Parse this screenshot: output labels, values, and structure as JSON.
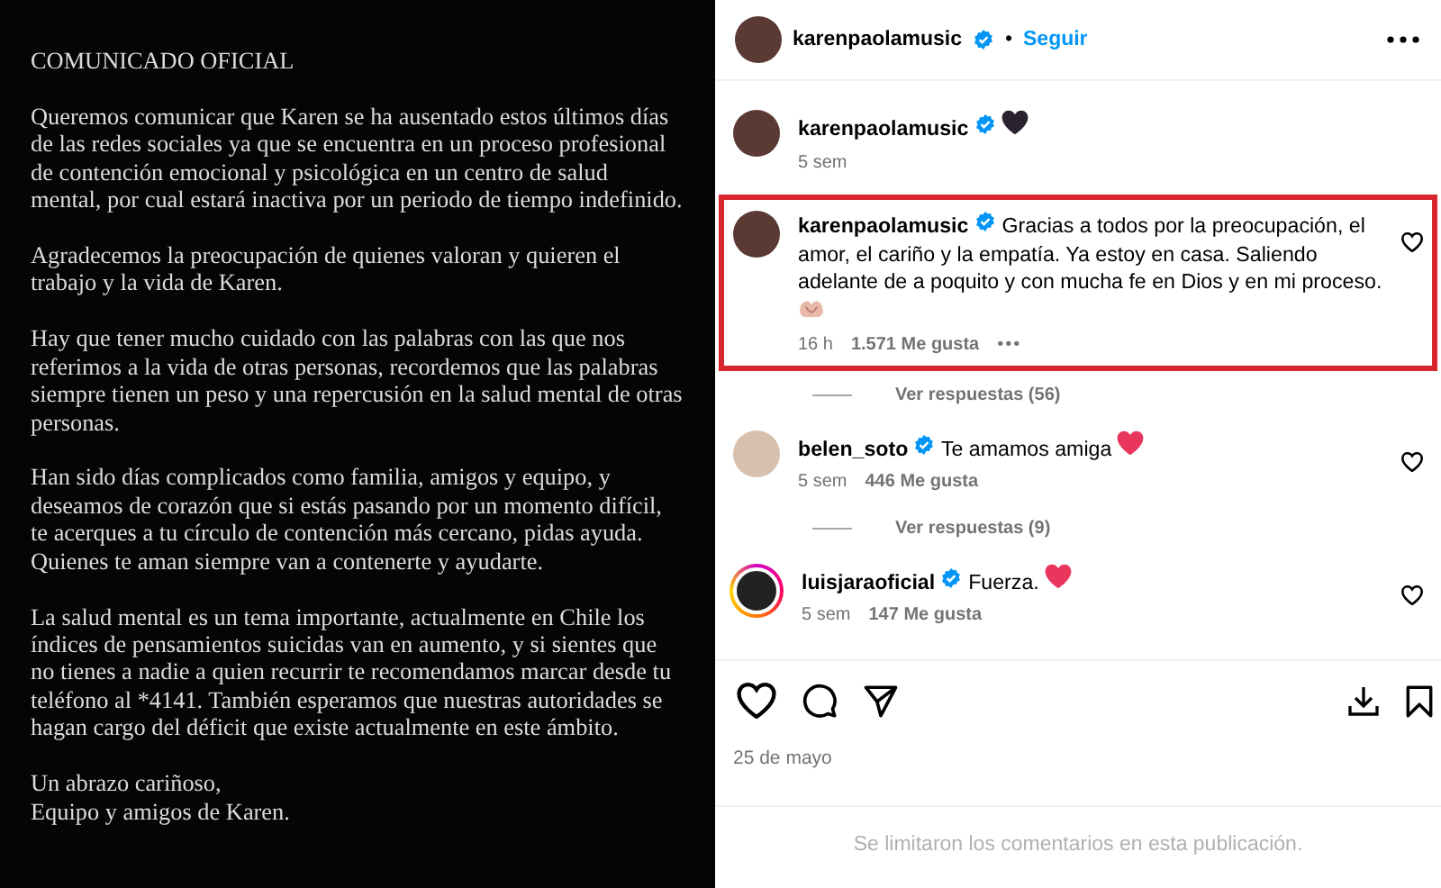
{
  "post_image": {
    "title": "COMUNICADO OFICIAL",
    "paragraphs": [
      "Queremos comunicar que Karen se ha ausentado estos últimos días de las redes sociales ya que se encuentra en un proceso profesional de contención emocional y psicológica en un centro de salud mental, por cual estará inactiva por un periodo de tiempo indefinido.",
      "Agradecemos la preocupación de quienes valoran y quieren el trabajo y la vida de Karen.",
      "Hay que tener mucho cuidado con las palabras con las que nos referimos a la vida de otras personas, recordemos que las palabras siempre tienen un peso y una repercusión en la salud mental de otras personas.",
      "Han sido días complicados como familia, amigos y equipo, y deseamos de corazón que si estás pasando por un momento difícil, te acerques a tu círculo de contención más cercano, pidas ayuda. Quienes te aman siempre van a contenerte y ayudarte.",
      "La salud mental es un tema importante, actualmente en Chile los índices de pensamientos suicidas van en aumento, y si sientes que no tienes a nadie a quien recurrir te recomendamos marcar desde tu teléfono al *4141. También esperamos que nuestras autoridades se hagan cargo del déficit que existe actualmente en este ámbito.",
      "Un abrazo cariñoso,\nEquipo y amigos de Karen."
    ]
  },
  "header": {
    "username": "karenpaolamusic",
    "verified": true,
    "separator": "•",
    "follow": "Seguir"
  },
  "comments": [
    {
      "username": "karenpaolamusic",
      "verified": true,
      "emoji": {
        "kind": "heart",
        "color": "#2b2230"
      },
      "time": "5 sem",
      "highlighted": false,
      "avatar_ring": false
    },
    {
      "username": "karenpaolamusic",
      "verified": true,
      "text": "Gracias a todos por la preocupación, el amor, el cariño y la empatía. Ya estoy en casa. Saliendo adelante de a poquito y con mucha fe en Dios y en mi proceso.",
      "emoji": {
        "kind": "hands",
        "color": "#e8b8a8"
      },
      "time": "16 h",
      "likes": "1.571 Me gusta",
      "more": "•••",
      "liked": false,
      "highlighted": true,
      "avatar_ring": false,
      "replies": "Ver respuestas (56)"
    },
    {
      "username": "belen_soto",
      "verified": true,
      "text": "Te amamos amiga",
      "emoji": {
        "kind": "heart",
        "color": "#e8365d"
      },
      "time": "5 sem",
      "likes": "446 Me gusta",
      "liked": false,
      "highlighted": false,
      "avatar_ring": false,
      "replies": "Ver respuestas (9)"
    },
    {
      "username": "luisjaraoficial",
      "verified": true,
      "text": "Fuerza.",
      "emoji": {
        "kind": "heart",
        "color": "#e8365d"
      },
      "time": "5 sem",
      "likes": "147 Me gusta",
      "liked": false,
      "highlighted": false,
      "avatar_ring": true
    }
  ],
  "date": "25 de mayo",
  "comments_notice": "Se limitaron los comentarios en esta publicación."
}
